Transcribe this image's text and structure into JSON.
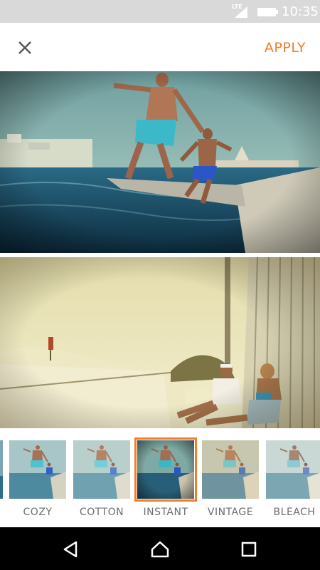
{
  "status_bar": {
    "network": "LTE",
    "time": "10:35",
    "icons": [
      "signal-icon",
      "battery-icon"
    ]
  },
  "toolbar": {
    "close_icon": "close-icon",
    "apply_label": "APPLY",
    "accent_color": "#ef7d2b"
  },
  "filters": {
    "items": [
      {
        "label": "COZY",
        "selected": false
      },
      {
        "label": "COTTON",
        "selected": false
      },
      {
        "label": "INSTANT",
        "selected": true
      },
      {
        "label": "VINTAGE",
        "selected": false
      },
      {
        "label": "BLEACH",
        "selected": false
      }
    ]
  },
  "nav": {
    "icons": [
      "back-icon",
      "home-icon",
      "recents-icon"
    ]
  }
}
